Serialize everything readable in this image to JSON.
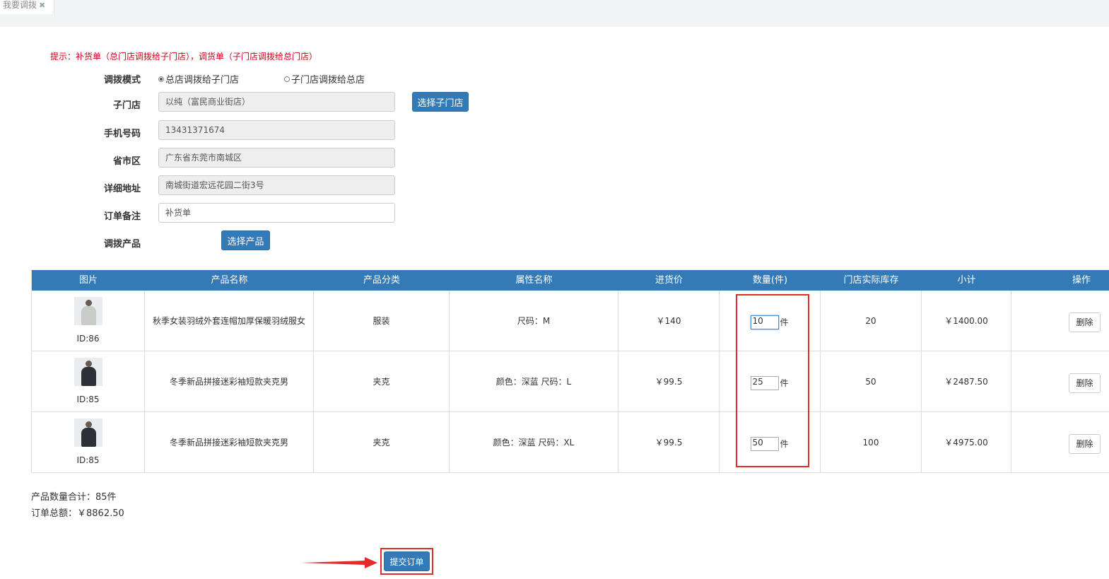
{
  "tab": {
    "title": "我要调拨",
    "close": "✖"
  },
  "hint": "提示：补货单（总门店调拨给子门店），调货单（子门店调拨给总门店）",
  "form": {
    "mode_label": "调拨模式",
    "mode_options": [
      "总店调拨给子门店",
      "子门店调拨给总店"
    ],
    "store_label": "子门店",
    "store_value": "以纯（富民商业街店）",
    "store_button": "选择子门店",
    "phone_label": "手机号码",
    "phone_value": "13431371674",
    "region_label": "省市区",
    "region_value": "广东省东莞市南城区",
    "address_label": "详细地址",
    "address_value": "南城街道宏远花园二街3号",
    "note_label": "订单备注",
    "note_value": "补货单",
    "product_label": "调拨产品",
    "product_button": "选择产品"
  },
  "table": {
    "headers": [
      "图片",
      "产品名称",
      "产品分类",
      "属性名称",
      "进货价",
      "数量(件)",
      "门店实际库存",
      "小计",
      "操作"
    ],
    "rows": [
      {
        "id": "ID:86",
        "name": "秋季女装羽绒外套连帽加厚保暖羽绒服女",
        "category": "服装",
        "attrs": "尺码：M",
        "price": "￥140",
        "qty": "10",
        "unit": "件",
        "stock": "20",
        "subtotal": "￥1400.00",
        "action": "删除"
      },
      {
        "id": "ID:85",
        "name": "冬季新品拼接迷彩袖短款夹克男",
        "category": "夹克",
        "attrs": "颜色：深蓝 尺码：L",
        "price": "￥99.5",
        "qty": "25",
        "unit": "件",
        "stock": "50",
        "subtotal": "￥2487.50",
        "action": "删除"
      },
      {
        "id": "ID:85",
        "name": "冬季新品拼接迷彩袖短款夹克男",
        "category": "夹克",
        "attrs": "颜色：深蓝 尺码：XL",
        "price": "￥99.5",
        "qty": "50",
        "unit": "件",
        "stock": "100",
        "subtotal": "￥4975.00",
        "action": "删除"
      }
    ]
  },
  "summary": {
    "total_qty": "产品数量合计：85件",
    "total_amount": "订单总额：￥8862.50"
  },
  "submit_label": "提交订单",
  "colors": {
    "primary": "#337ab7",
    "hint": "#d0021b",
    "annotation": "#e32b2b"
  }
}
